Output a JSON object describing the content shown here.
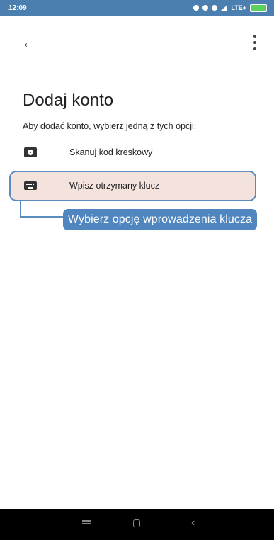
{
  "status_bar": {
    "time": "12:09",
    "network": "LTE+",
    "icons": [
      "bluetooth-icon",
      "vibrate-icon",
      "alarm-icon",
      "signal-icon",
      "battery-icon"
    ],
    "colors": {
      "background": "#4a7fb0",
      "battery": "#5bd15b"
    }
  },
  "app_bar": {
    "back_icon": "arrow-left-icon",
    "more_icon": "more-vert-icon"
  },
  "page": {
    "title": "Dodaj konto",
    "subtitle": "Aby dodać konto, wybierz jedną z tych opcji:"
  },
  "options": [
    {
      "icon": "camera-icon",
      "label": "Skanuj kod kreskowy"
    },
    {
      "icon": "keyboard-icon",
      "label": "Wpisz otrzymany klucz",
      "highlighted": true
    }
  ],
  "annotation": {
    "callout_text": "Wybierz opcję wprowadzenia klucza",
    "colors": {
      "outline": "#5b8cc0",
      "fill": "#4f86bf",
      "highlight": "#e7c2b4"
    }
  },
  "nav_bar": {
    "icons": [
      "menu-icon",
      "home-icon",
      "back-icon"
    ]
  }
}
